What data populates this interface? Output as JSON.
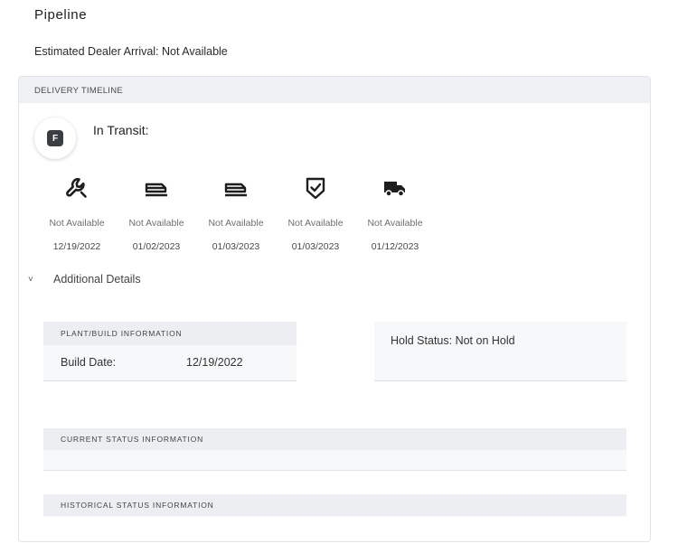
{
  "page": {
    "title": "Pipeline",
    "estimated_arrival": "Estimated Dealer Arrival: Not Available"
  },
  "timeline": {
    "header": "DELIVERY TIMELINE",
    "badge_letter": "F",
    "status_label": "In Transit:",
    "steps": [
      {
        "icon": "wrench-icon",
        "status": "Not Available",
        "date": "12/19/2022"
      },
      {
        "icon": "rail-car-icon",
        "status": "Not Available",
        "date": "01/02/2023"
      },
      {
        "icon": "rail-car-icon",
        "status": "Not Available",
        "date": "01/03/2023"
      },
      {
        "icon": "shield-check-icon",
        "status": "Not Available",
        "date": "01/03/2023"
      },
      {
        "icon": "truck-icon",
        "status": "Not Available",
        "date": "01/12/2023"
      }
    ]
  },
  "additional_details": {
    "label": "Additional Details",
    "plant": {
      "header": "PLANT/BUILD INFORMATION",
      "build_date_label": "Build Date:",
      "build_date_value": "12/19/2022"
    },
    "hold_status": "Hold Status: Not on Hold",
    "current_status_header": "CURRENT STATUS INFORMATION",
    "historical_status_header": "HISTORICAL STATUS INFORMATION"
  }
}
